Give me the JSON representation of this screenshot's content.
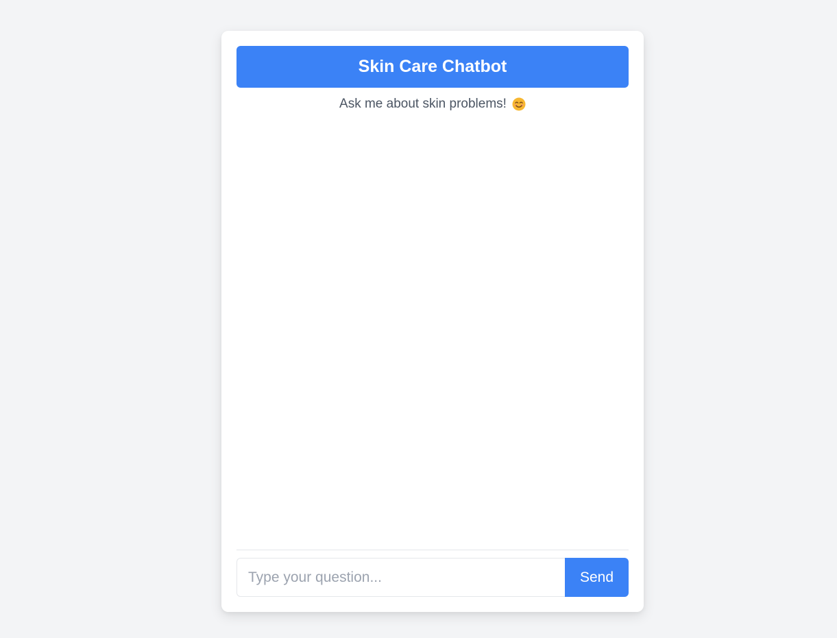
{
  "chatbot": {
    "title": "Skin Care Chatbot",
    "subtitle": "Ask me about skin problems!",
    "subtitle_icon": "smiling-face-icon",
    "messages": []
  },
  "composer": {
    "placeholder": "Type your question...",
    "value": "",
    "send_label": "Send"
  },
  "colors": {
    "accent": "#3b82f6",
    "page_background": "#f3f4f6",
    "card_background": "#ffffff",
    "subtitle_text": "#4b5563",
    "placeholder_text": "#9ca3af"
  }
}
